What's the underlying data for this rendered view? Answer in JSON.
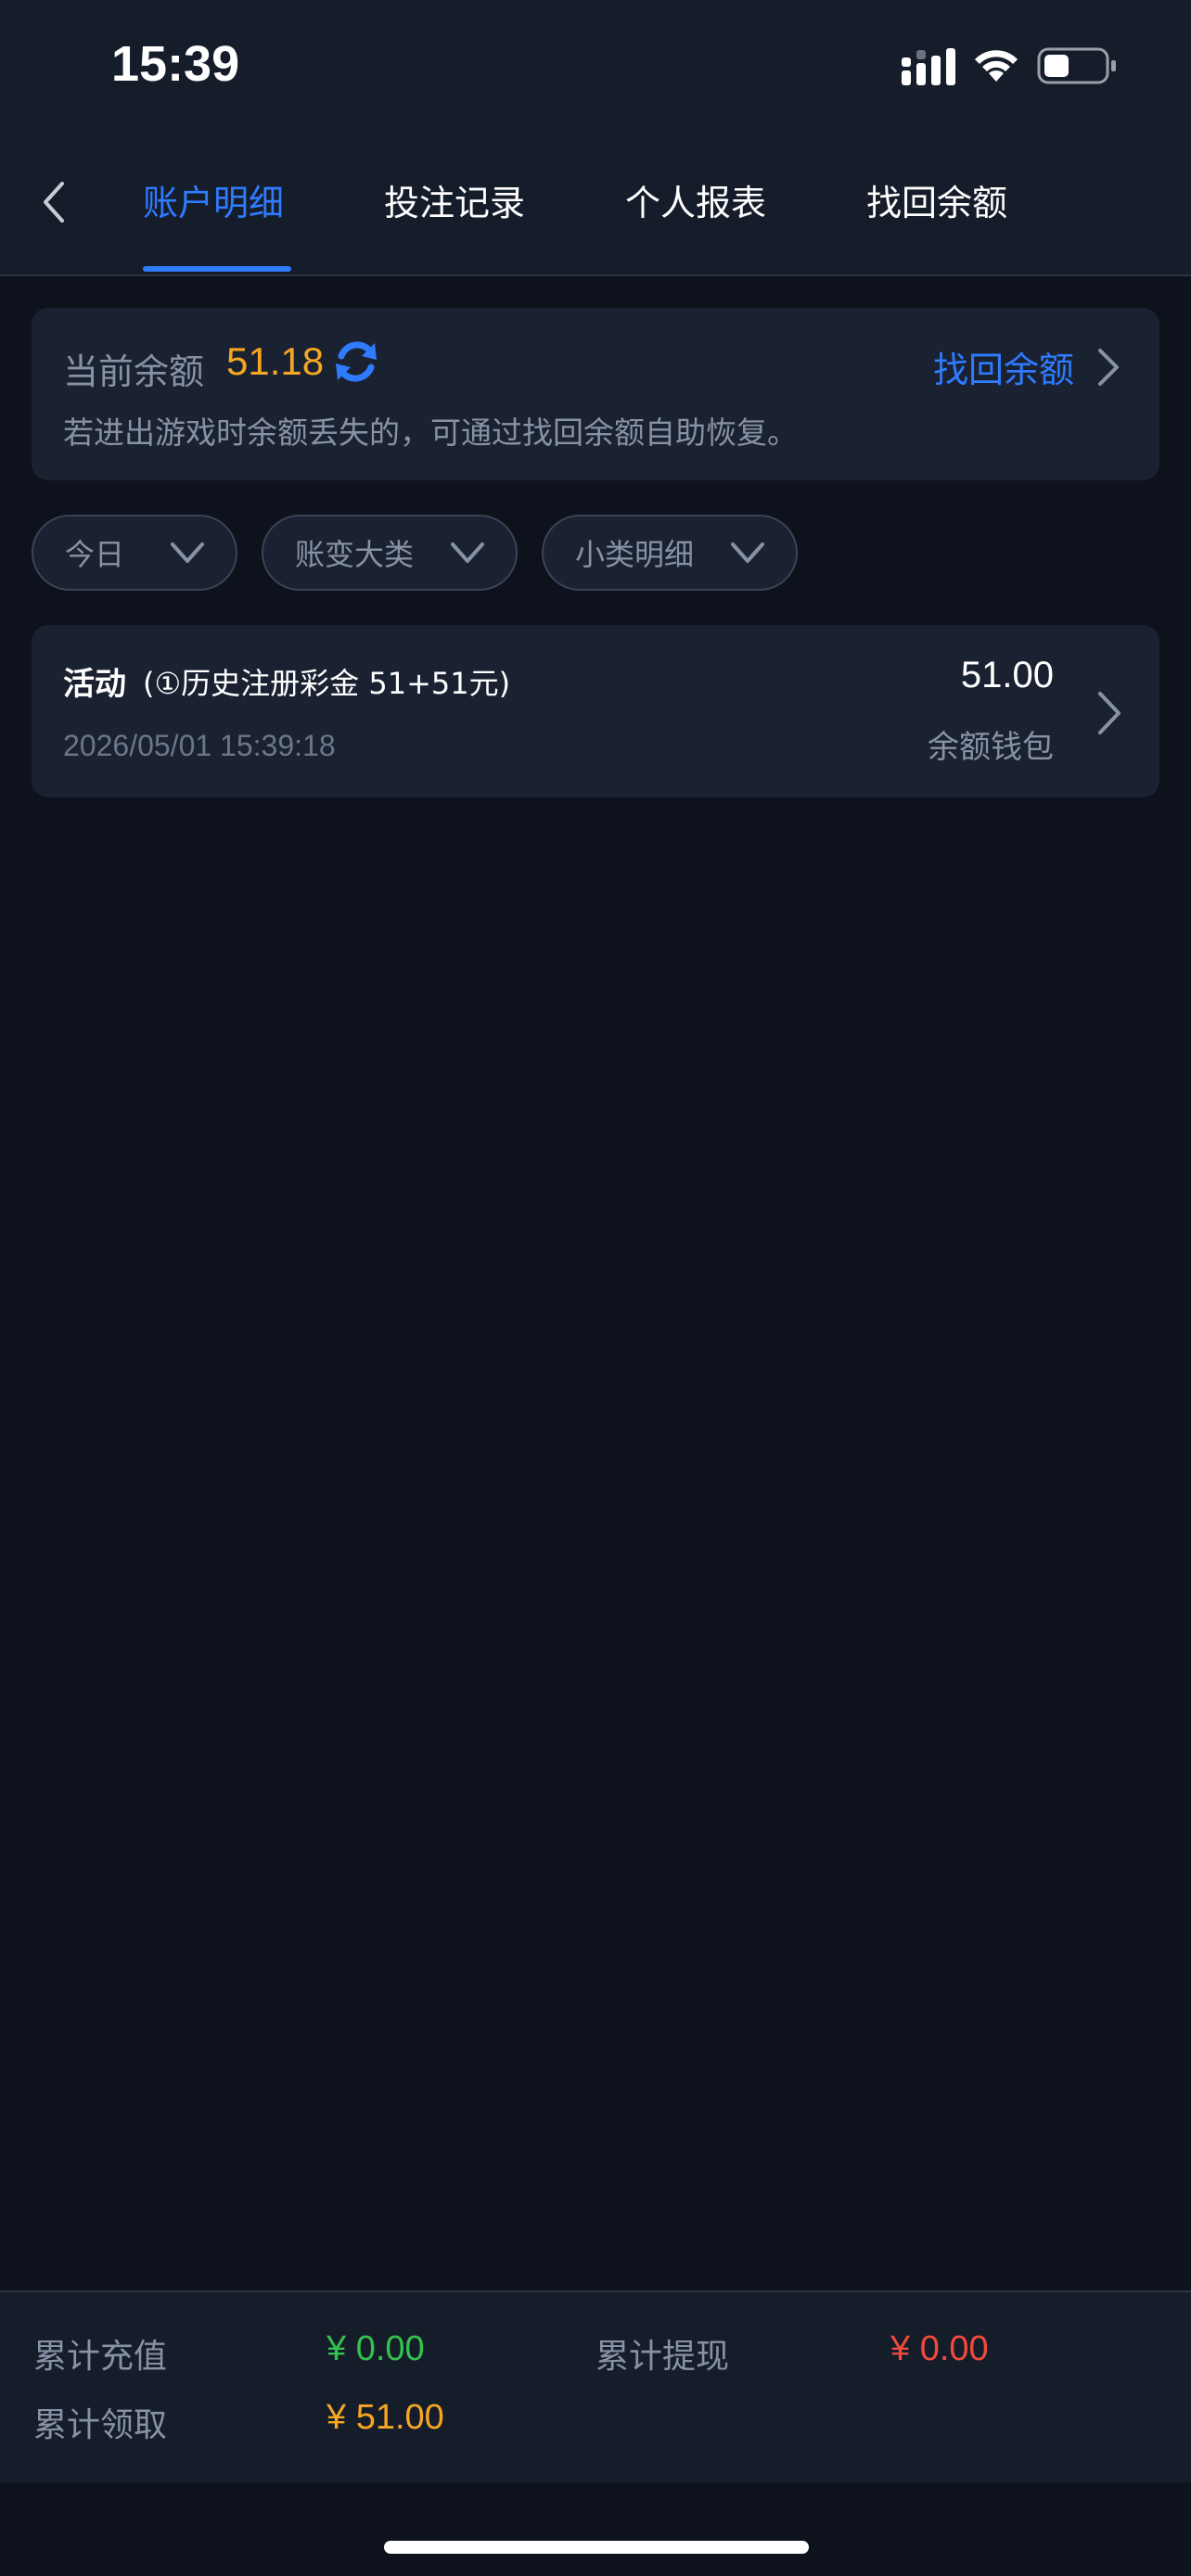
{
  "status_bar": {
    "time": "15:39"
  },
  "nav": {
    "tabs": [
      {
        "label": "账户明细",
        "active": true
      },
      {
        "label": "投注记录",
        "active": false
      },
      {
        "label": "个人报表",
        "active": false
      },
      {
        "label": "找回余额",
        "active": false
      }
    ]
  },
  "balance_card": {
    "label": "当前余额",
    "value": "51.18",
    "recover_label": "找回余额",
    "hint": "若进出游戏时余额丢失的，可通过找回余额自助恢复。"
  },
  "filters": [
    {
      "label": "今日"
    },
    {
      "label": "账变大类"
    },
    {
      "label": "小类明细"
    }
  ],
  "records": [
    {
      "category": "活动",
      "description": "(①历史注册彩金 51+51元)",
      "time": "2026/05/01 15:39:18",
      "amount": "51.00",
      "wallet": "余额钱包"
    }
  ],
  "summary": {
    "recharge_label": "累计充值",
    "recharge_value": "¥ 0.00",
    "withdraw_label": "累计提现",
    "withdraw_value": "¥ 0.00",
    "claim_label": "累计领取",
    "claim_value": "¥ 51.00"
  },
  "colors": {
    "accent": "#2f7bff",
    "balance": "#f5a623",
    "recharge": "#33c24d",
    "withdraw": "#f04b3a",
    "claim": "#f5a623"
  }
}
